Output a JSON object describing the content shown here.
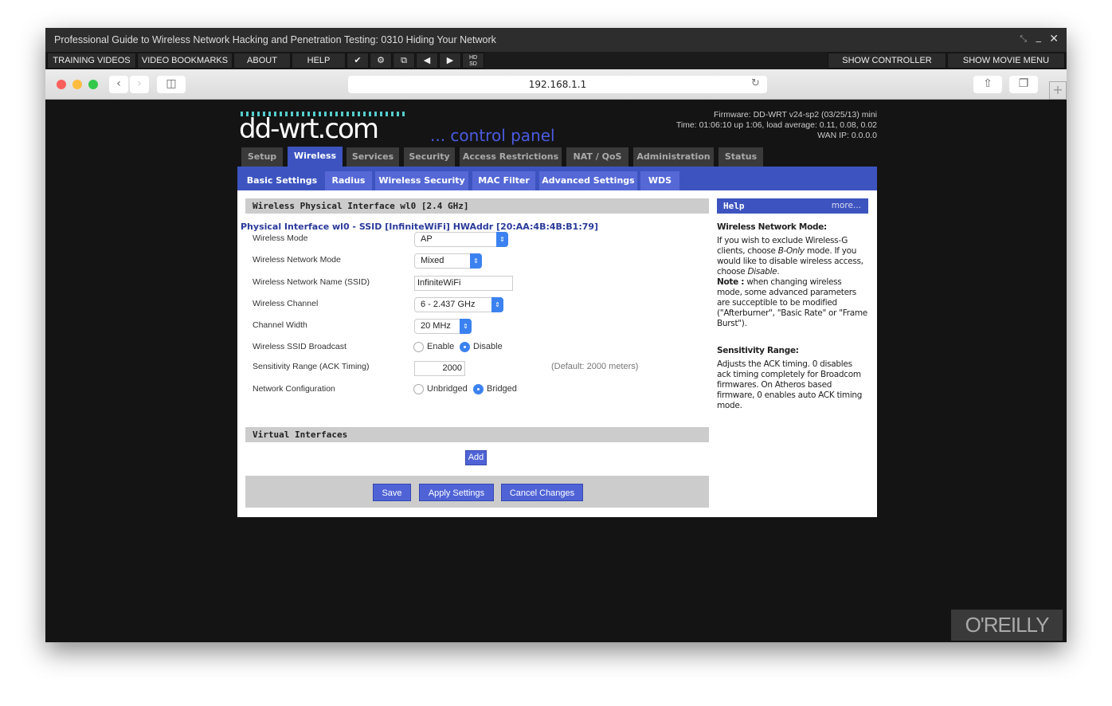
{
  "window": {
    "title": "Professional Guide to Wireless Network Hacking and Penetration Testing: 0310 Hiding Your Network"
  },
  "menubar": {
    "items": [
      "TRAINING VIDEOS",
      "VIDEO BOOKMARKS",
      "ABOUT",
      "HELP"
    ],
    "right": [
      "SHOW CONTROLLER",
      "SHOW MOVIE MENU"
    ],
    "hd": "HD",
    "sd": "SD"
  },
  "browser": {
    "url": "192.168.1.1"
  },
  "ddwrt": {
    "logo": "dd-wrt.com",
    "subtitle": "... control panel",
    "firmware": "Firmware: DD-WRT v24-sp2 (03/25/13) mini",
    "time": "Time: 01:06:10 up 1:06, load average: 0.11, 0.08, 0.02",
    "wan": "WAN IP: 0.0.0.0",
    "tabs": [
      "Setup",
      "Wireless",
      "Services",
      "Security",
      "Access Restrictions",
      "NAT / QoS",
      "Administration",
      "Status"
    ],
    "active_tab": "Wireless",
    "subtabs": [
      "Basic Settings",
      "Radius",
      "Wireless Security",
      "MAC Filter",
      "Advanced Settings",
      "WDS"
    ],
    "active_subtab": "Basic Settings",
    "section1": "Wireless Physical Interface wl0 [2.4 GHz]",
    "iface": "Physical Interface wl0 - SSID [InfiniteWiFi] HWAddr [20:AA:4B:4B:B1:79]",
    "fields": {
      "mode": {
        "label": "Wireless Mode",
        "value": "AP"
      },
      "netmode": {
        "label": "Wireless Network Mode",
        "value": "Mixed"
      },
      "ssid": {
        "label": "Wireless Network Name (SSID)",
        "value": "InfiniteWiFi"
      },
      "channel": {
        "label": "Wireless Channel",
        "value": "6 - 2.437 GHz"
      },
      "width": {
        "label": "Channel Width",
        "value": "20 MHz"
      },
      "broadcast": {
        "label": "Wireless SSID Broadcast",
        "opt1": "Enable",
        "opt2": "Disable",
        "selected": "Disable"
      },
      "ack": {
        "label": "Sensitivity Range (ACK Timing)",
        "value": "2000",
        "hint": "(Default: 2000 meters)"
      },
      "netconf": {
        "label": "Network Configuration",
        "opt1": "Unbridged",
        "opt2": "Bridged",
        "selected": "Bridged"
      }
    },
    "section2": "Virtual Interfaces",
    "add": "Add",
    "save": "Save",
    "apply": "Apply Settings",
    "cancel": "Cancel Changes",
    "help": {
      "title": "Help",
      "more": "more...",
      "h1": "Wireless Network Mode:",
      "p1a": "If you wish to exclude Wireless-G clients, choose ",
      "p1b": "B-Only",
      "p1c": " mode. If you would like to disable wireless access, choose ",
      "p1d": "Disable",
      "p1e": ".",
      "note": "Note :",
      "p2": " when changing wireless mode, some advanced parameters are succeptible to be modified (\"Afterburner\", \"Basic Rate\" or \"Frame Burst\").",
      "h2": "Sensitivity Range:",
      "p3": "Adjusts the ACK timing. 0 disables ack timing completely for Broadcom firmwares. On Atheros based firmware, 0 enables auto ACK timing mode."
    }
  },
  "watermark": "O'REILLY",
  "colors": {
    "accent": "#3d54c0",
    "button": "#4f63d6",
    "radio": "#3b82f0"
  }
}
